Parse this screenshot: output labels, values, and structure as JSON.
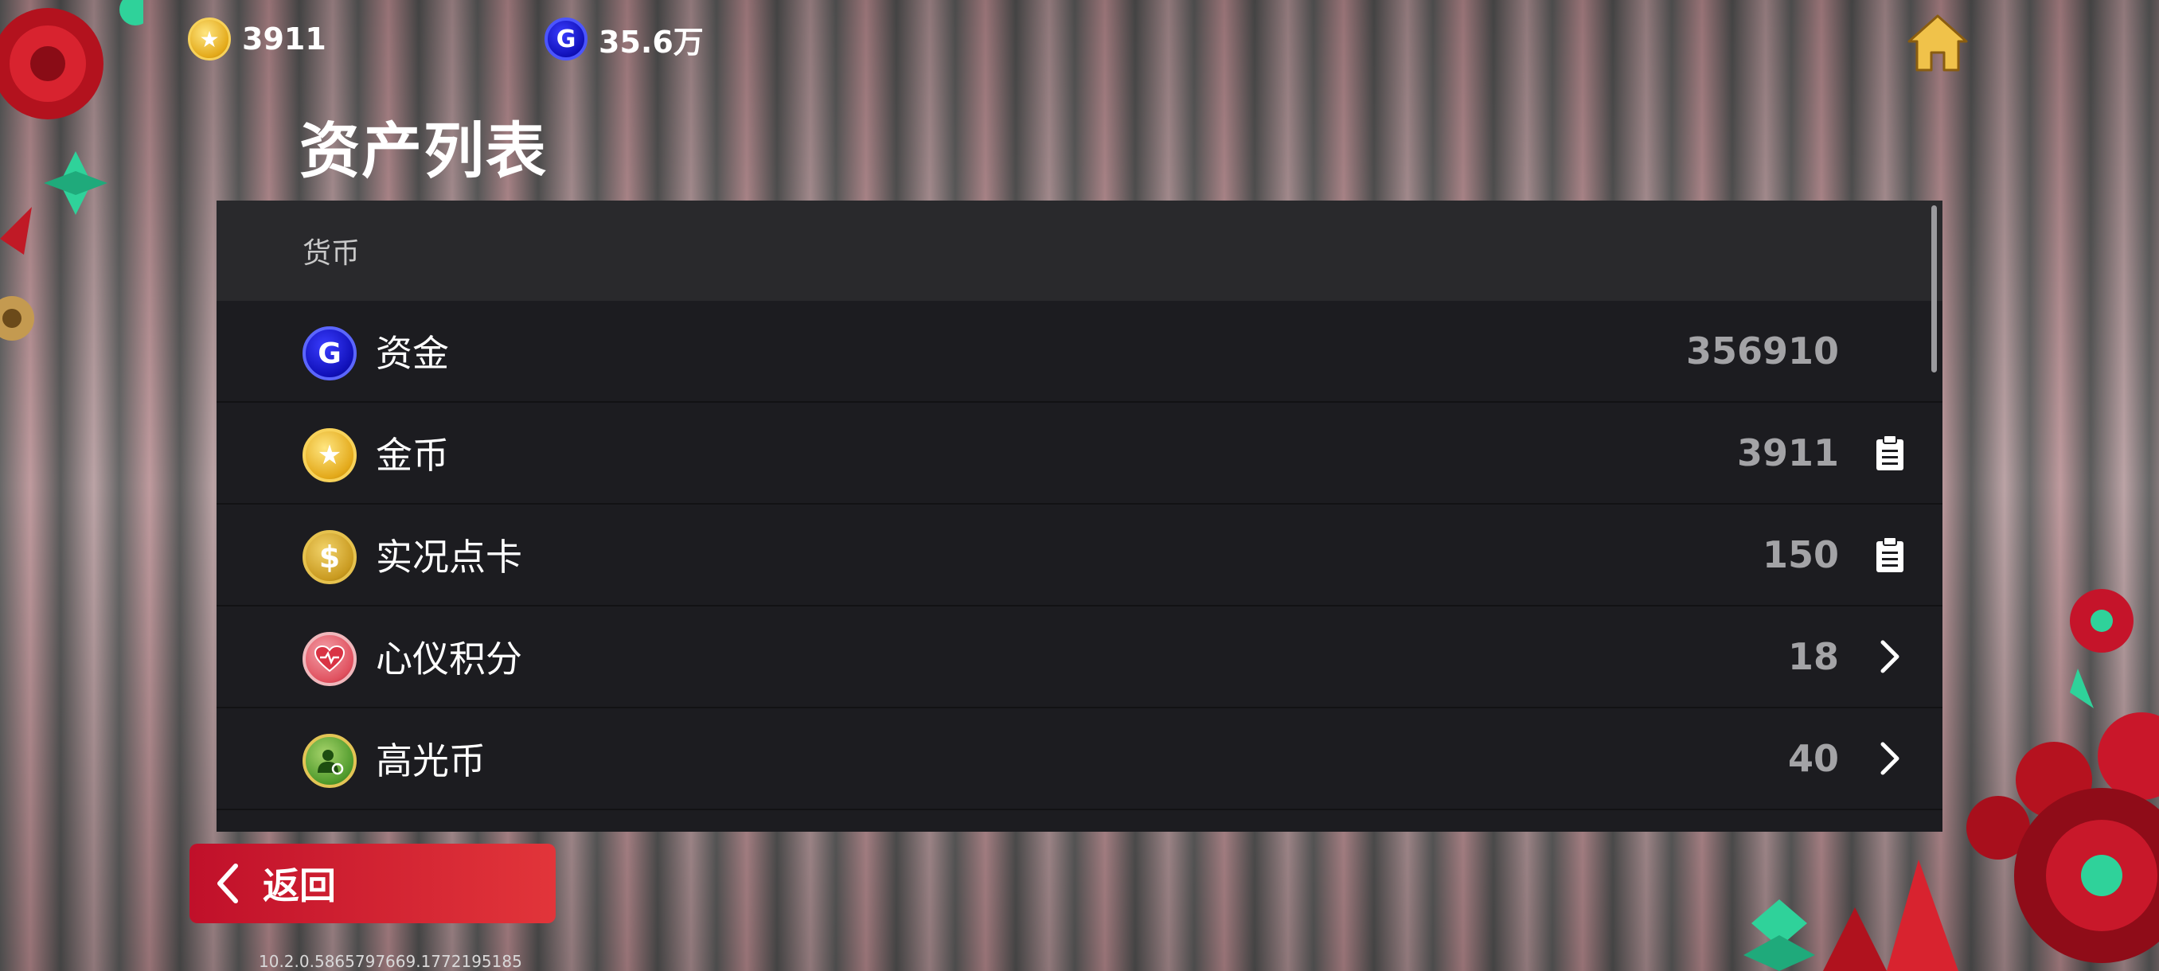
{
  "header": {
    "gold": {
      "icon": "gold-star-coin-icon",
      "value": "3911"
    },
    "funds": {
      "icon": "blue-g-coin-icon",
      "value": "35.6万"
    },
    "home_icon": "home-icon"
  },
  "page": {
    "title": "资产列表"
  },
  "asset_list": {
    "section_title": "货币",
    "rows": [
      {
        "icon": "blue-g-coin-icon",
        "label": "资金",
        "amount": "356910",
        "action": ""
      },
      {
        "icon": "gold-star-coin-icon",
        "label": "金币",
        "amount": "3911",
        "action": "clipboard-icon"
      },
      {
        "icon": "gold-dollar-coin-icon",
        "label": "实况点卡",
        "amount": "150",
        "action": "clipboard-icon"
      },
      {
        "icon": "heart-pulse-coin-icon",
        "label": "心仪积分",
        "amount": "18",
        "action": "chevron-right-icon"
      },
      {
        "icon": "green-player-coin-icon",
        "label": "高光币",
        "amount": "40",
        "action": "chevron-right-icon"
      }
    ]
  },
  "footer": {
    "back_label": "返回",
    "version": "10.2.0.5865797669.1772195185"
  },
  "colors": {
    "accent_red": "#d5202f",
    "panel": "#1c1c20",
    "panel_header": "#29292c"
  }
}
